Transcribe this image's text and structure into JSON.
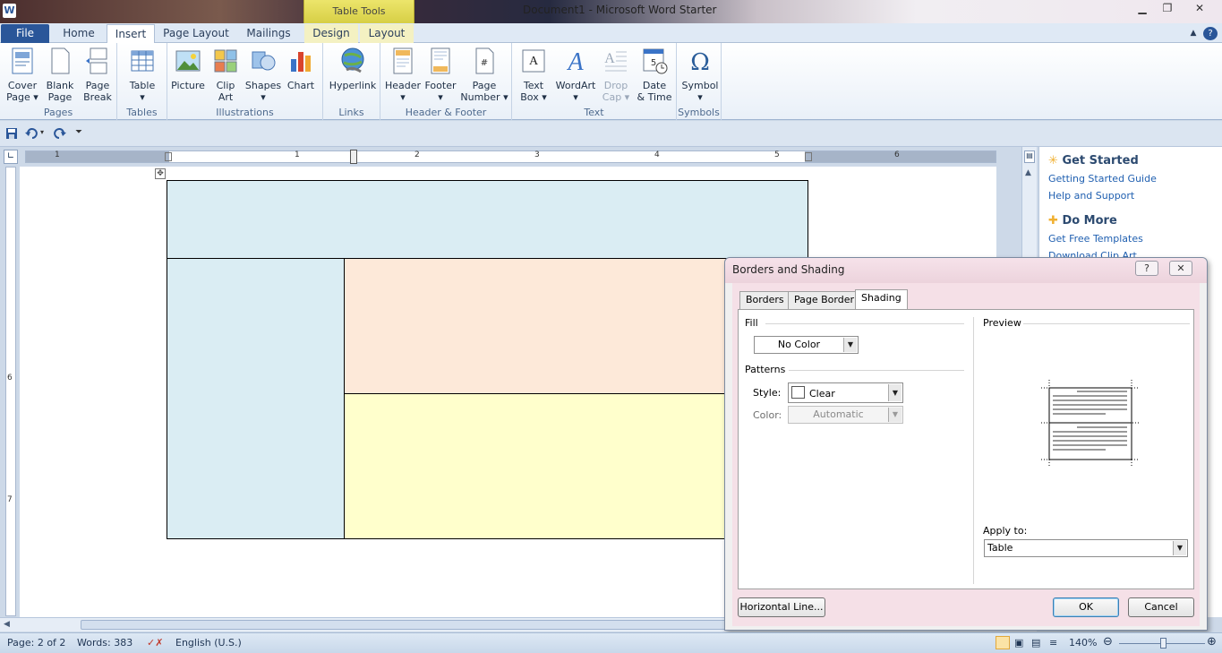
{
  "window": {
    "title": "Document1  -  Microsoft Word Starter",
    "context_tab_group": "Table Tools",
    "app_logo_letter": "W",
    "controls": {
      "minimize": "▁",
      "maximize": "❐",
      "close": "✕"
    }
  },
  "tabs": [
    {
      "label": "File"
    },
    {
      "label": "Home"
    },
    {
      "label": "Insert"
    },
    {
      "label": "Page Layout"
    },
    {
      "label": "Mailings"
    },
    {
      "label": "Design"
    },
    {
      "label": "Layout"
    }
  ],
  "ribbon": {
    "groups": {
      "pages": "Pages",
      "tables": "Tables",
      "illustrations": "Illustrations",
      "links": "Links",
      "header_footer": "Header & Footer",
      "text": "Text",
      "symbols": "Symbols"
    },
    "buttons": {
      "cover_page": [
        "Cover",
        "Page ▾"
      ],
      "blank_page": [
        "Blank",
        "Page"
      ],
      "page_break": [
        "Page",
        "Break"
      ],
      "table": [
        "Table",
        "▾"
      ],
      "picture": [
        "Picture"
      ],
      "clip_art": [
        "Clip",
        "Art"
      ],
      "shapes": [
        "Shapes",
        "▾"
      ],
      "chart": [
        "Chart"
      ],
      "hyperlink": [
        "Hyperlink"
      ],
      "header": [
        "Header",
        "▾"
      ],
      "footer": [
        "Footer",
        "▾"
      ],
      "page_number": [
        "Page",
        "Number ▾"
      ],
      "text_box": [
        "Text",
        "Box ▾"
      ],
      "wordart": [
        "WordArt",
        "▾"
      ],
      "drop_cap": [
        "Drop",
        "Cap ▾"
      ],
      "date_time": [
        "Date",
        "& Time"
      ],
      "symbol": [
        "Symbol",
        "▾"
      ]
    }
  },
  "ruler": {
    "numbers": [
      "1",
      "1",
      "2",
      "3",
      "4",
      "5",
      "6"
    ]
  },
  "vruler": {
    "numbers": [
      "6",
      "7"
    ]
  },
  "colors": {
    "cell_blue": "#daedf3",
    "cell_peach": "#fde9d9",
    "cell_yellow": "#ffffcc"
  },
  "pane": {
    "get_started_title": "Get Started",
    "links1": [
      "Getting Started Guide",
      "Help and Support"
    ],
    "do_more_title": "Do More",
    "links2": [
      "Get Free Templates",
      "Download Clip Art"
    ]
  },
  "dialog": {
    "title": "Borders and Shading",
    "help": "?",
    "close": "✕",
    "tabs": [
      "Borders",
      "Page Border",
      "Shading"
    ],
    "fill_label": "Fill",
    "fill_value": "No Color",
    "patterns_label": "Patterns",
    "style_label": "Style:",
    "style_value": "Clear",
    "color_label": "Color:",
    "color_value": "Automatic",
    "preview_label": "Preview",
    "apply_to_label": "Apply to:",
    "apply_to_value": "Table",
    "horizontal_line_button": "Horizontal Line...",
    "ok_button": "OK",
    "cancel_button": "Cancel"
  },
  "status": {
    "page": "Page: 2 of 2",
    "words": "Words: 383",
    "language": "English (U.S.)",
    "zoom": "140%"
  }
}
